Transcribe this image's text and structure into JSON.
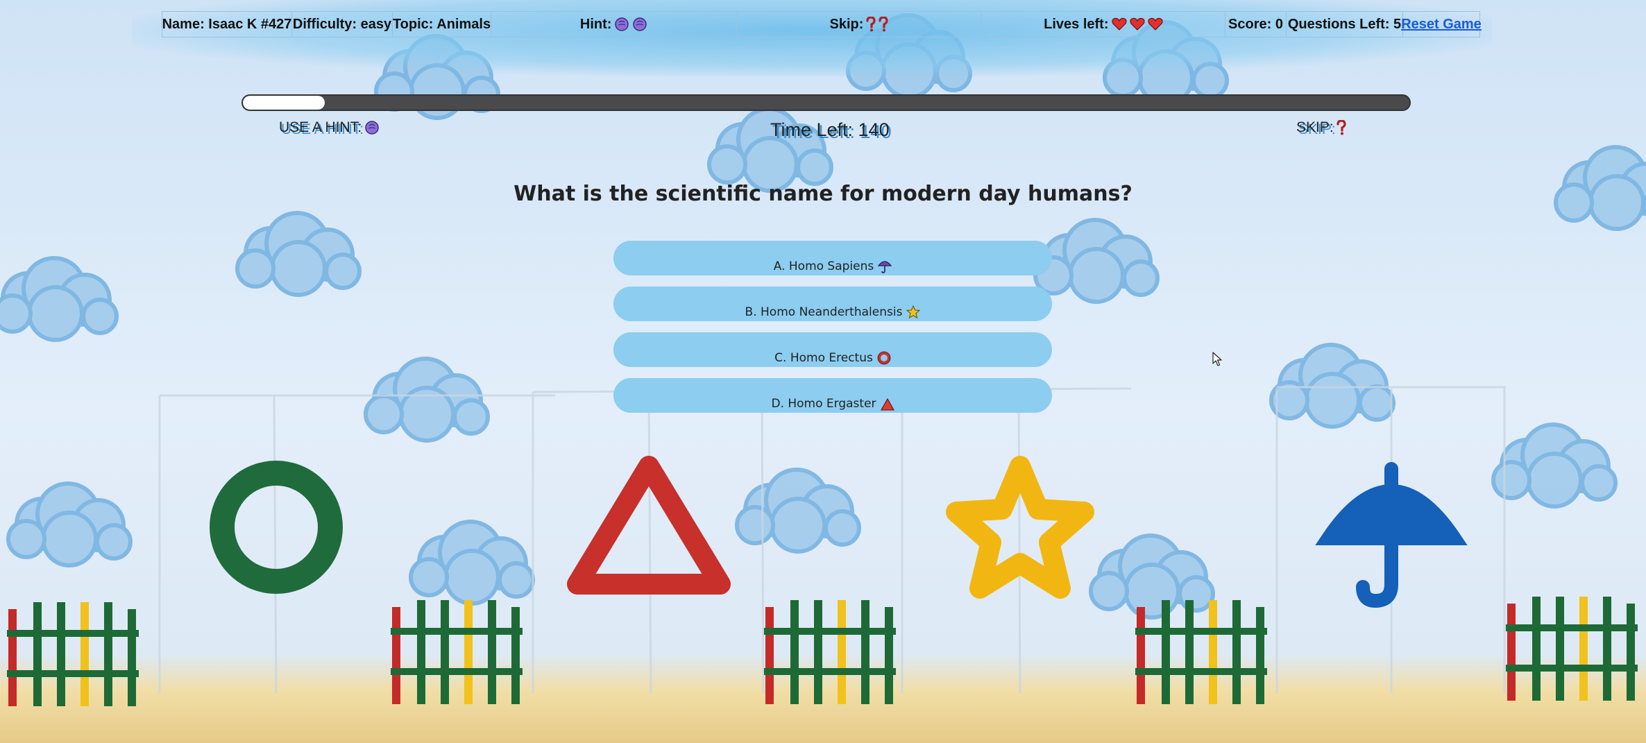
{
  "status": {
    "name": "Name: Isaac K #427",
    "difficulty": "Difficulty: easy",
    "topic": "Topic: Animals",
    "hint_label": "Hint:",
    "hint_icons": [
      "brain-icon",
      "brain-icon"
    ],
    "skip_label": "Skip:",
    "skip_icons": [
      "question-mark-icon",
      "question-mark-icon"
    ],
    "lives_label": "Lives left:",
    "lives_icons": [
      "heart-icon",
      "heart-icon",
      "heart-icon"
    ],
    "score": "Score: 0",
    "questions_left": "Questions Left: 5",
    "reset_label": "Reset Game"
  },
  "timer": {
    "progress_fraction": 0.07,
    "time_left": "Time Left: 140"
  },
  "controls": {
    "use_hint_label": "USE A HINT:",
    "use_hint_icon": "brain-icon",
    "skip_label": "SKIP:",
    "skip_icon": "question-mark-icon"
  },
  "question": {
    "text": "What is the scientific name for modern day humans?"
  },
  "answers": [
    {
      "label": "A. Homo Sapiens",
      "icon": "umbrella-icon"
    },
    {
      "label": "B. Homo Neanderthalensis",
      "icon": "star-icon"
    },
    {
      "label": "C. Homo Erectus",
      "icon": "circle-icon"
    },
    {
      "label": "D. Homo Ergaster",
      "icon": "triangle-icon"
    }
  ],
  "colors": {
    "accent": "#8ccdf0",
    "link": "#1a5bd6",
    "progress_track": "#4a4a4c",
    "circle": "#1f6b3c",
    "triangle": "#c8302b",
    "star": "#f2b612",
    "umbrella": "#1560b8"
  }
}
